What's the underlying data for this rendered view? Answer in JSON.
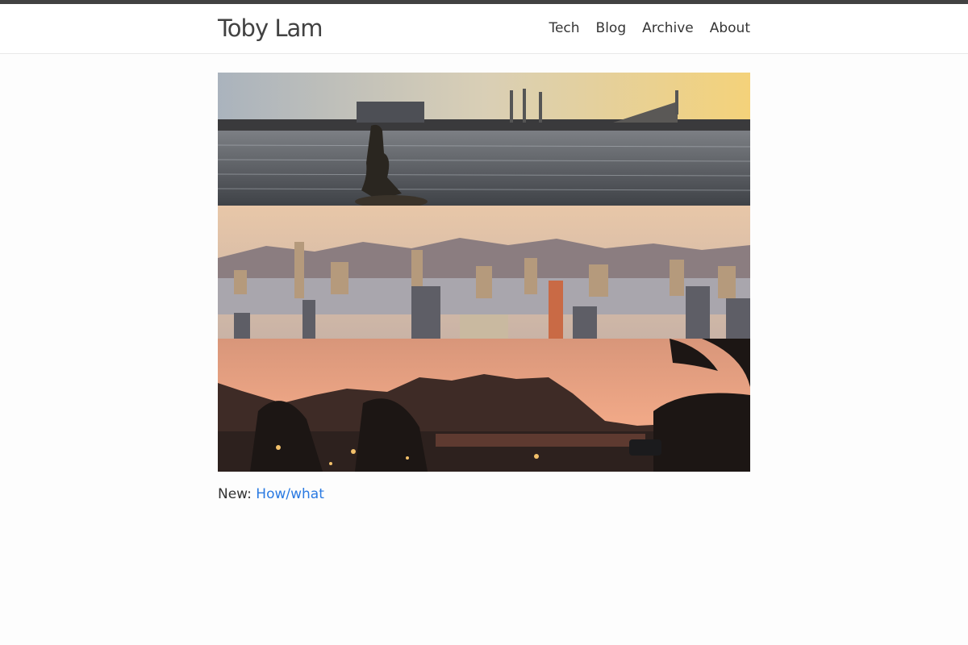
{
  "site": {
    "title": "Toby Lam"
  },
  "nav": {
    "items": [
      {
        "label": "Tech"
      },
      {
        "label": "Blog"
      },
      {
        "label": "Archive"
      },
      {
        "label": "About"
      }
    ]
  },
  "main": {
    "new_prefix": "New:",
    "new_link": "How/what"
  },
  "colors": {
    "topbar": "#424242",
    "link": "#2a7ae2",
    "text": "#333333"
  }
}
